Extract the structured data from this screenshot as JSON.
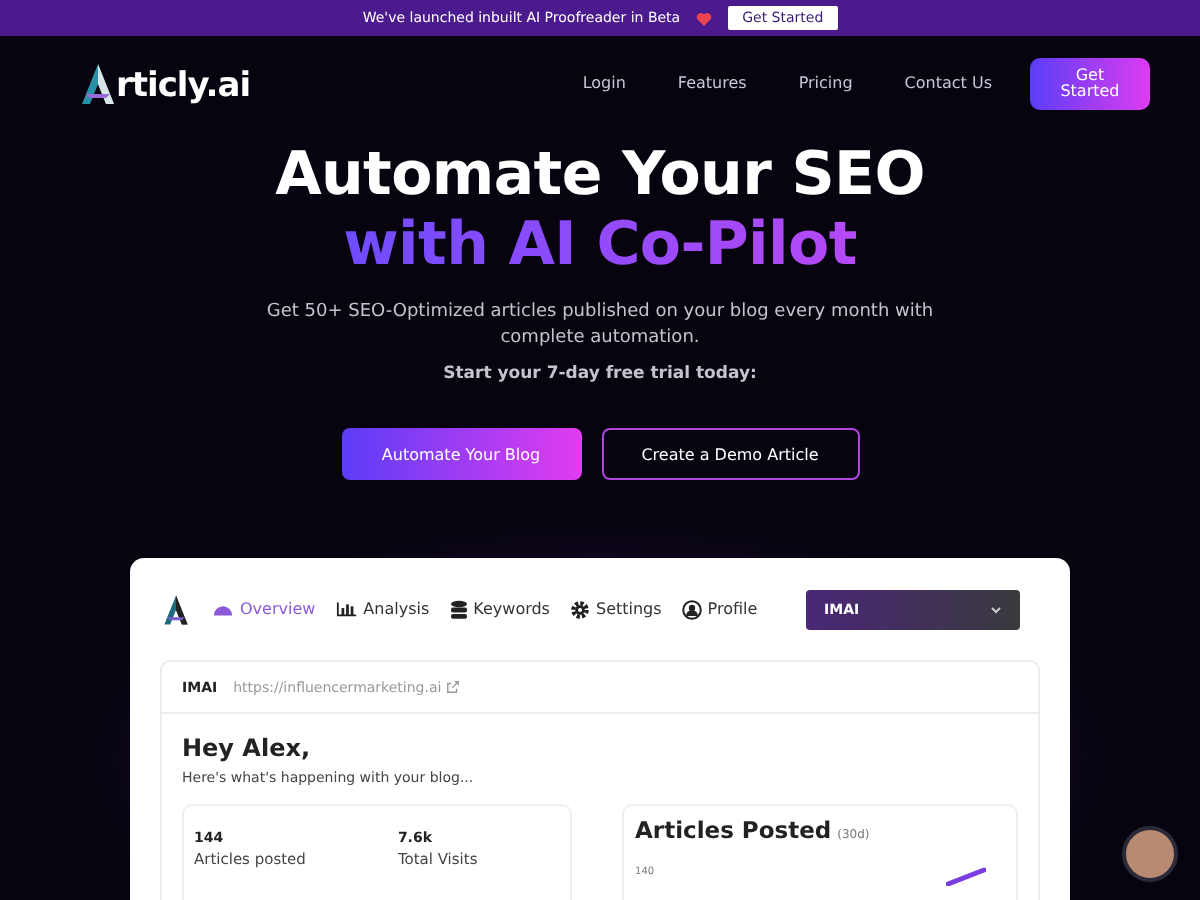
{
  "banner": {
    "text": "We've launched inbuilt AI Proofreader in Beta",
    "button": "Get Started"
  },
  "nav": {
    "logo_text": "rticly.ai",
    "links": [
      "Login",
      "Features",
      "Pricing",
      "Contact Us"
    ],
    "cta": "Get Started"
  },
  "hero": {
    "title_line_1": "Automate Your SEO",
    "title_line_2": "with AI Co-Pilot",
    "subtitle": "Get 50+ SEO-Optimized articles published on your blog every month with complete automation.",
    "trial_text": "Start your 7-day free trial today:",
    "buttons": [
      {
        "label": "Automate Your Blog",
        "kind": "primary"
      },
      {
        "label": "Create a Demo Article",
        "kind": "outline"
      }
    ]
  },
  "dashboard": {
    "tabs": [
      {
        "label": "Overview",
        "selected": true
      },
      {
        "label": "Analysis",
        "selected": false
      },
      {
        "label": "Keywords",
        "selected": false
      },
      {
        "label": "Settings",
        "selected": false
      },
      {
        "label": "Profile",
        "selected": false
      }
    ],
    "site_select": "IMAI",
    "site_name": "IMAI",
    "site_url": "https://influencermarketing.ai",
    "greeting": "Hey Alex,",
    "greeting_sub": "Here's what's happening with your blog...",
    "stats": [
      {
        "value": "144",
        "label": "Articles posted"
      },
      {
        "value": "7.6k",
        "label": "Total Visits"
      }
    ],
    "chart": {
      "title": "Articles Posted",
      "period": "(30d)",
      "tick": "140"
    }
  }
}
